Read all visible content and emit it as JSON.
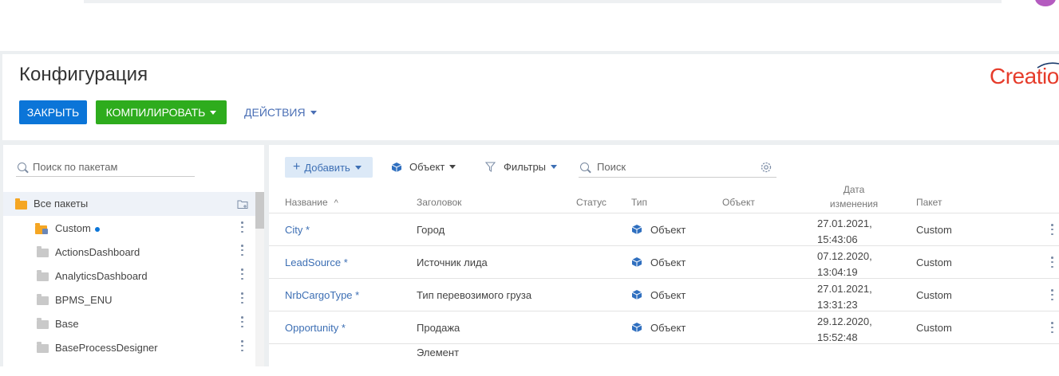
{
  "header": {
    "title": "Конфигурация",
    "logo": "Creatio",
    "buttons": {
      "close": "ЗАКРЫТЬ",
      "compile": "КОМПИЛИРОВАТЬ",
      "actions": "ДЕЙСТВИЯ"
    },
    "colors": {
      "close": "#0b75d8",
      "compile": "#2eac1d",
      "logo": "#e63c2b"
    }
  },
  "packages": {
    "search_placeholder": "Поиск по пакетам",
    "all_label": "Все пакеты",
    "items": [
      {
        "label": "Custom",
        "icon": "folder-lock-icon",
        "modified": true
      },
      {
        "label": "ActionsDashboard",
        "icon": "folder-icon"
      },
      {
        "label": "AnalyticsDashboard",
        "icon": "folder-icon"
      },
      {
        "label": "BPMS_ENU",
        "icon": "folder-icon"
      },
      {
        "label": "Base",
        "icon": "folder-icon"
      },
      {
        "label": "BaseProcessDesigner",
        "icon": "folder-icon"
      }
    ]
  },
  "toolbar": {
    "add": "Добавить",
    "type_filter": "Объект",
    "filters": "Фильтры",
    "search_placeholder": "Поиск"
  },
  "table": {
    "columns": {
      "name": "Название",
      "caption": "Заголовок",
      "status": "Статус",
      "type": "Тип",
      "object": "Объект",
      "date_line1": "Дата",
      "date_line2": "изменения",
      "package": "Пакет"
    },
    "rows": [
      {
        "name": "City",
        "mark": "*",
        "caption": "Город",
        "type": "Объект",
        "date1": "27.01.2021,",
        "date2": "15:43:06",
        "package": "Custom"
      },
      {
        "name": "LeadSource",
        "mark": "*",
        "caption": "Источник лида",
        "type": "Объект",
        "date1": "07.12.2020,",
        "date2": "13:04:19",
        "package": "Custom"
      },
      {
        "name": "NrbCargoType",
        "mark": "*",
        "caption": "Тип перевозимого груза",
        "type": "Объект",
        "date1": "27.01.2021,",
        "date2": "13:31:23",
        "package": "Custom"
      },
      {
        "name": "Opportunity",
        "mark": "*",
        "caption": "Продажа",
        "type": "Объект",
        "date1": "29.12.2020,",
        "date2": "15:52:48",
        "package": "Custom"
      },
      {
        "name": "",
        "mark": "",
        "caption": "Элемент",
        "type": "",
        "date1": "",
        "date2": "",
        "package": ""
      }
    ]
  }
}
